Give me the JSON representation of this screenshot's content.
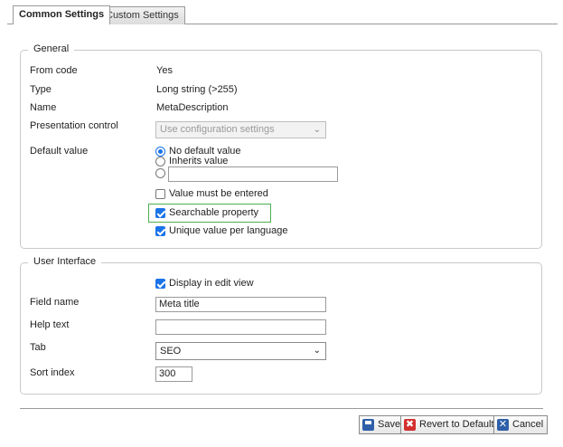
{
  "tabs": [
    {
      "label": "Common Settings",
      "active": true
    },
    {
      "label": "Custom Settings",
      "active": false
    }
  ],
  "general": {
    "legend": "General",
    "rows": {
      "from_code": {
        "label": "From code",
        "value": "Yes"
      },
      "type": {
        "label": "Type",
        "value": "Long string (>255)"
      },
      "name": {
        "label": "Name",
        "value": "MetaDescription"
      },
      "presentation": {
        "label": "Presentation control",
        "value": "Use configuration settings"
      },
      "default_value": {
        "label": "Default value",
        "options": [
          "No default value",
          "Inherits value"
        ],
        "custom_value": "",
        "selected": "No default value"
      }
    },
    "checks": {
      "must_enter": {
        "label": "Value must be entered",
        "checked": false
      },
      "searchable": {
        "label": "Searchable property",
        "checked": true
      },
      "unique_lang": {
        "label": "Unique value per language",
        "checked": true
      }
    }
  },
  "ui": {
    "legend": "User Interface",
    "display_edit": {
      "label": "Display in edit view",
      "checked": true
    },
    "field_name": {
      "label": "Field name",
      "value": "Meta title"
    },
    "help_text": {
      "label": "Help text",
      "value": ""
    },
    "tab": {
      "label": "Tab",
      "value": "SEO"
    },
    "sort_index": {
      "label": "Sort index",
      "value": "300"
    }
  },
  "buttons": {
    "save": "Save",
    "revert": "Revert to Default",
    "cancel": "Cancel"
  },
  "colors": {
    "accent": "#1a73e8",
    "highlight_border": "#4caf50"
  }
}
